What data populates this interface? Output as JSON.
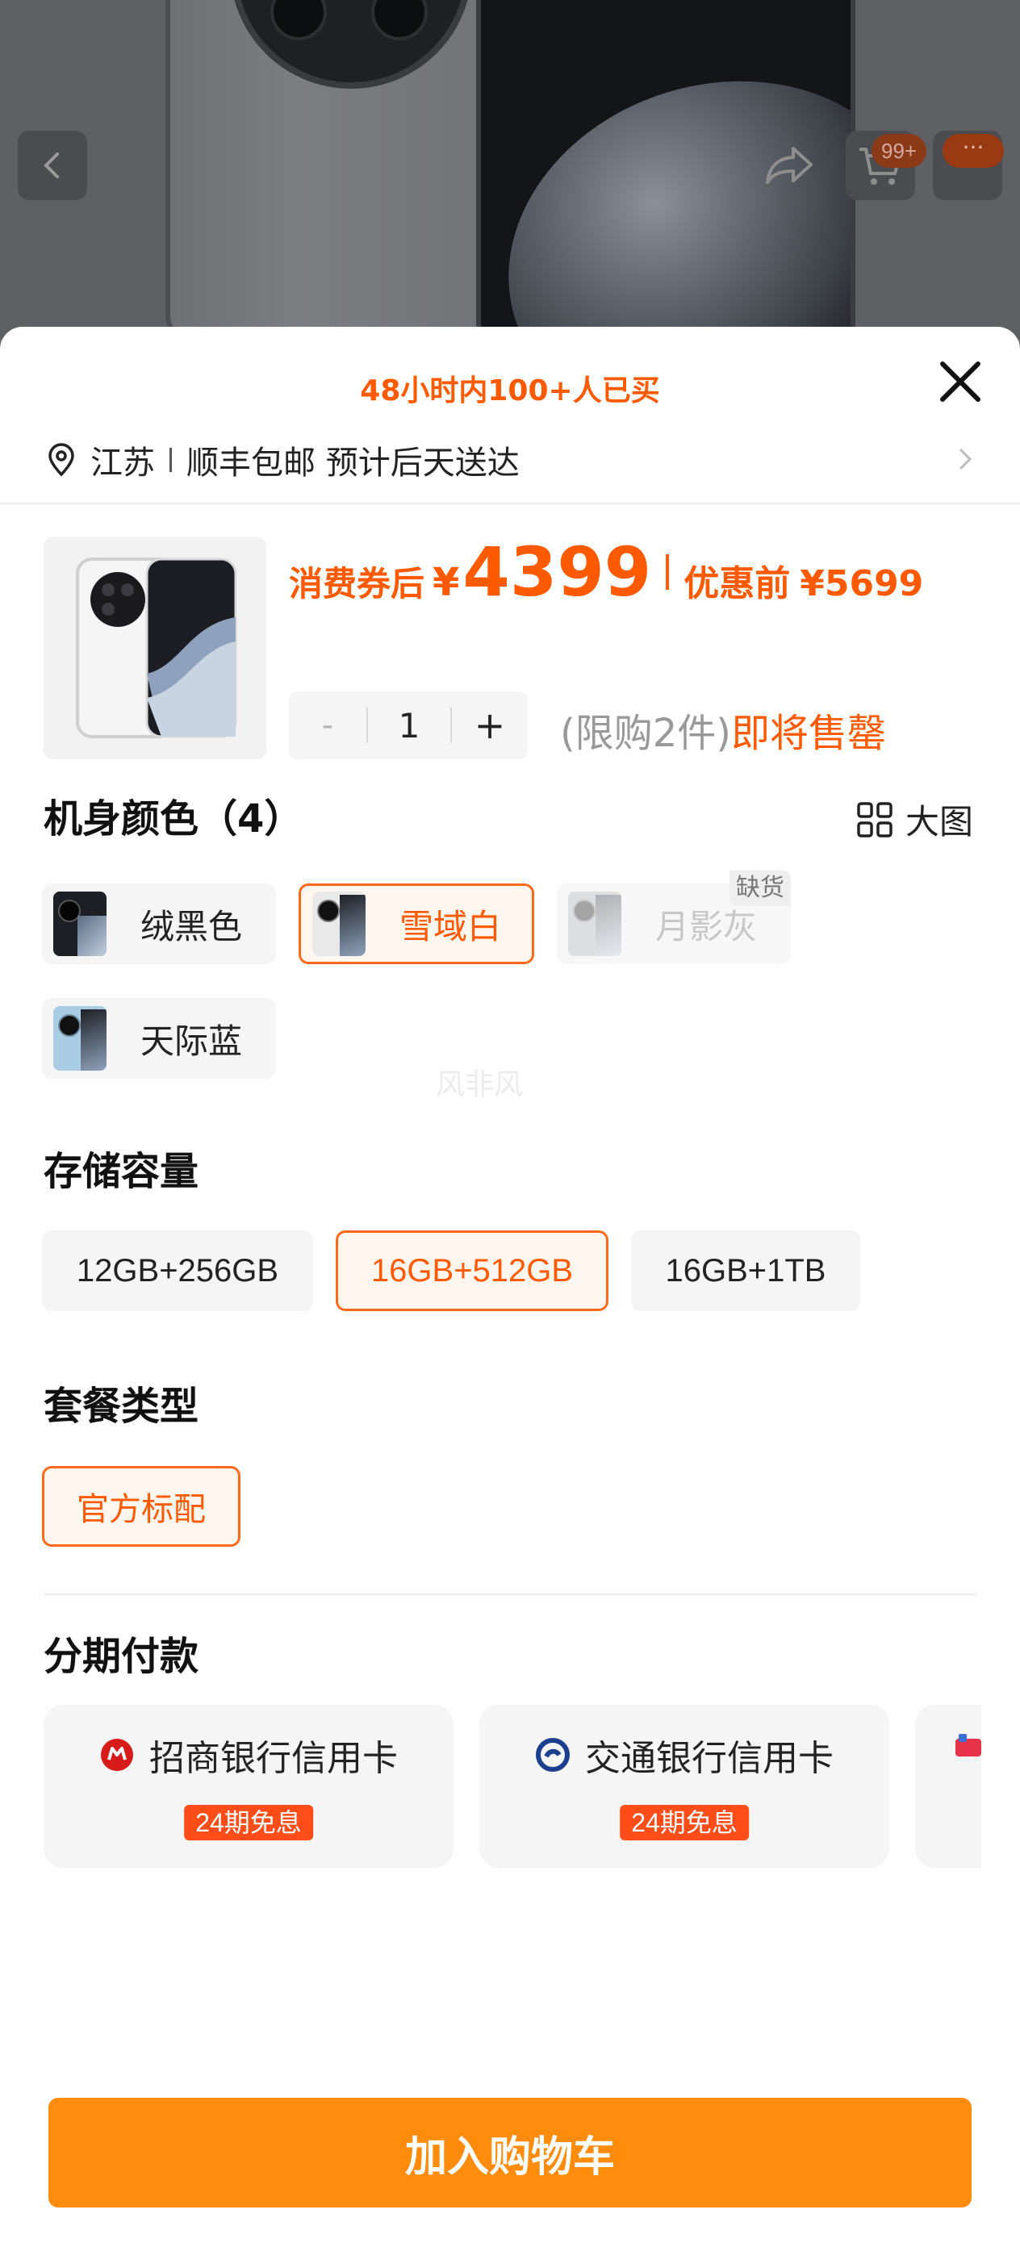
{
  "header": {
    "cart_badge": "99+",
    "more_badge": "···",
    "icons": [
      "chevron-left-icon",
      "share-icon",
      "cart-icon",
      "more-icon"
    ]
  },
  "sheet": {
    "hot_sales": "48小时内100+人已买",
    "address": {
      "region": "江苏",
      "shipping": "顺丰包邮 预计后天送达"
    },
    "price": {
      "after_coupon_label": "消费券后",
      "currency": "¥",
      "after_coupon_value": "4399",
      "before_label": "优惠前",
      "before_value": "¥5699"
    },
    "quantity": {
      "minus": "-",
      "value": "1",
      "plus": "+"
    },
    "limit": {
      "text": "(限购2件)",
      "status": "即将售罄"
    },
    "color_section": {
      "title": "机身颜色（4）",
      "big_image_label": "大图",
      "options": [
        {
          "label": "绒黑色",
          "state": "normal"
        },
        {
          "label": "雪域白",
          "state": "selected"
        },
        {
          "label": "月影灰",
          "state": "disabled",
          "badge": "缺货"
        },
        {
          "label": "天际蓝",
          "state": "normal"
        }
      ]
    },
    "watermark": "风非风",
    "storage_section": {
      "title": "存储容量",
      "options": [
        {
          "label": "12GB+256GB",
          "state": "normal"
        },
        {
          "label": "16GB+512GB",
          "state": "selected"
        },
        {
          "label": "16GB+1TB",
          "state": "normal"
        }
      ]
    },
    "package_section": {
      "title": "套餐类型",
      "options": [
        {
          "label": "官方标配",
          "state": "selected"
        }
      ]
    },
    "installment_section": {
      "title": "分期付款",
      "cards": [
        {
          "name": "招商银行信用卡",
          "tag": "24期免息"
        },
        {
          "name": "交通银行信用卡",
          "tag": "24期免息"
        },
        {
          "name": "",
          "tag": ""
        }
      ]
    },
    "add_to_cart": "加入购物车"
  },
  "colors": {
    "accent": "#ff5a00",
    "button": "#ff8c0d",
    "tag": "#ff4d1a"
  }
}
